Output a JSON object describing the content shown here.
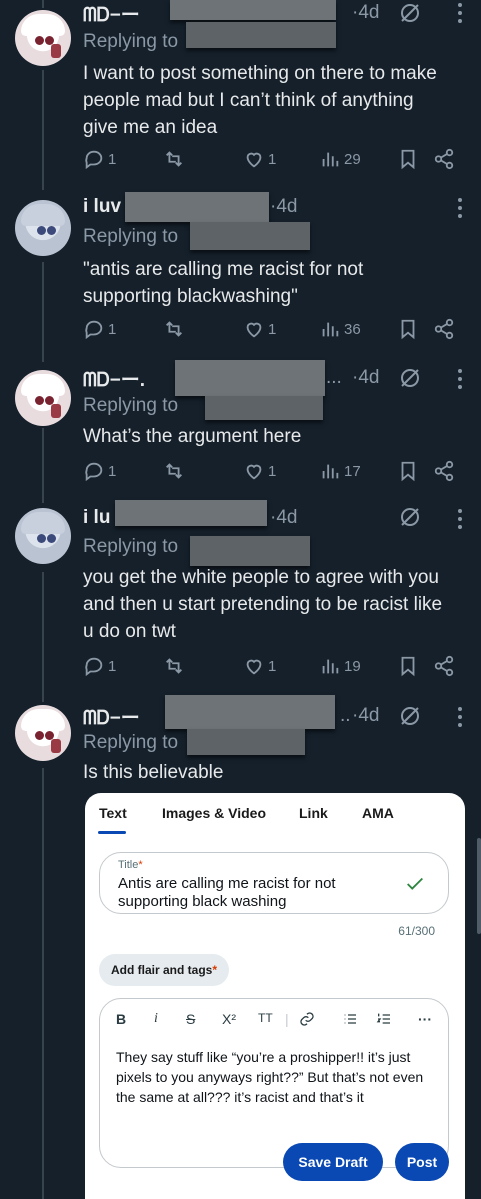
{
  "tweets": [
    {
      "name": "ᗰᎠ−ー",
      "time": "·4d",
      "replying": "Replying to",
      "text": "I want to post something on there to make people mad but I can’t think of anything give me an idea",
      "replies": "1",
      "likes": "1",
      "views": "29"
    },
    {
      "name": "i luv",
      "time": "·4d",
      "replying": "Replying to",
      "text": "\"antis are calling me racist for not supporting blackwashing\"",
      "replies": "1",
      "likes": "1",
      "views": "36"
    },
    {
      "name": "ᗰᎠ−ー.",
      "time": "·4d",
      "ellipsis": "...",
      "replying": "Replying to",
      "text": "What’s the argument here",
      "replies": "1",
      "likes": "1",
      "views": "17"
    },
    {
      "name": "i lu",
      "time": "·4d",
      "replying": "Replying to",
      "text": "you get the white people to agree with you and then u start pretending to be racist like u do on twt",
      "replies": "1",
      "likes": "1",
      "views": "19"
    },
    {
      "name": "ᗰᎠ−ー",
      "time": "·4d",
      "ellipsis": "..",
      "replying": "Replying to",
      "text": "Is this believable"
    }
  ],
  "composer": {
    "tabs": [
      "Text",
      "Images & Video",
      "Link",
      "AMA"
    ],
    "active_tab": "Text",
    "title_label": "Title",
    "required_mark": "*",
    "title_value": "Antis are calling me racist for not supporting black washing",
    "char_count": "61/300",
    "flair_label": "Add flair and tags",
    "toolbar": [
      "B",
      "i",
      "S",
      "X²",
      "TT",
      "|",
      "link",
      "bullets",
      "numbers",
      "···"
    ],
    "body": "They say stuff like “you’re a proshipper!! it’s just pixels to you anyways right??” But that’s not even the same at all??? it’s racist and that’s it",
    "save_draft_label": "Save Draft",
    "post_label": "Post"
  },
  "colors": {
    "background": "#15202b",
    "muted": "#8b98a5",
    "text": "#e7e9ea",
    "accent": "#0a49b3"
  }
}
